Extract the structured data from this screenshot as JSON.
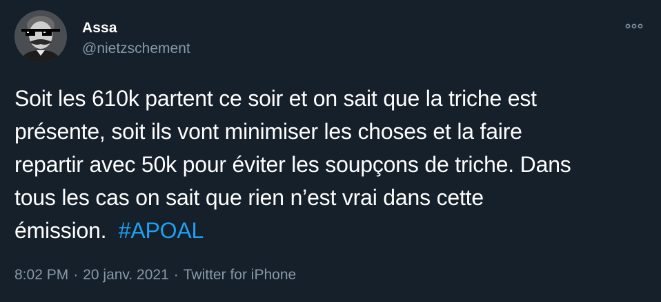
{
  "author": {
    "name": "Assa",
    "handle": "@nietzschement",
    "avatar_icon": "avatar-icon"
  },
  "menu": {
    "icon": "more-options-icon"
  },
  "tweet": {
    "lines": [
      "Soit les 610k partent ce soir et on sait que la triche est",
      "présente, soit ils vont minimiser les choses et la faire",
      "repartir avec 50k pour éviter les soupçons de triche. Dans",
      "tous les cas on sait que rien n’est vrai dans cette"
    ],
    "last_line_text": "émission.",
    "hashtag": "#APOAL"
  },
  "meta": {
    "time": "8:02 PM",
    "separator": "·",
    "date": "20 janv. 2021",
    "source": "Twitter for iPhone"
  },
  "colors": {
    "background": "#15202b",
    "text_primary": "#ffffff",
    "text_secondary": "#8899a6",
    "link": "#1da1f2"
  }
}
